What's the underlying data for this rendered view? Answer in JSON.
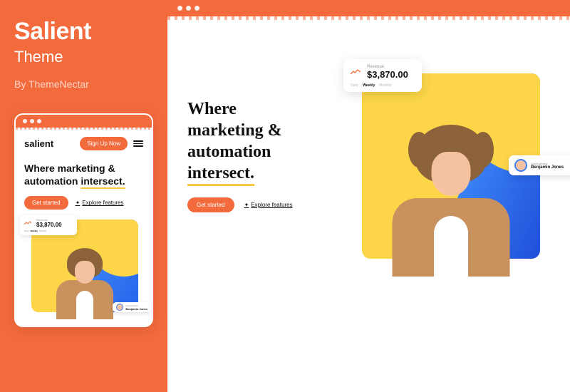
{
  "theme": {
    "name": "Salient",
    "subtitle": "Theme",
    "author": "By ThemeNectar"
  },
  "colors": {
    "brand": "#f36a3d",
    "accent": "#f9c846",
    "blue": "#2563eb"
  },
  "mobile": {
    "logo": "salient",
    "signup_label": "Sign Up Now",
    "hero_line1": "Where marketing &",
    "hero_line2_prefix": "automation ",
    "hero_line2_underlined": "intersect.",
    "cta_primary": "Get started",
    "cta_secondary": "Explore features",
    "revenue": {
      "label": "Revenue",
      "value": "$3,870.00",
      "tabs": [
        "Daily",
        "Weekly",
        "Monthly"
      ],
      "active_tab": "Weekly"
    },
    "user": {
      "role": "Administrator",
      "name": "Benjamin Jones"
    }
  },
  "desktop": {
    "hero_line1": "Where",
    "hero_line2": "marketing &",
    "hero_line3": "automation",
    "hero_line4_underlined": "intersect.",
    "cta_primary": "Get started",
    "cta_secondary": "Explore features",
    "revenue": {
      "label": "Revenue",
      "value": "$3,870.00",
      "tabs": [
        "Daily",
        "Weekly",
        "Monthly"
      ],
      "active_tab": "Weekly"
    },
    "user": {
      "role": "Administrator",
      "name": "Benjamin Jones"
    }
  }
}
